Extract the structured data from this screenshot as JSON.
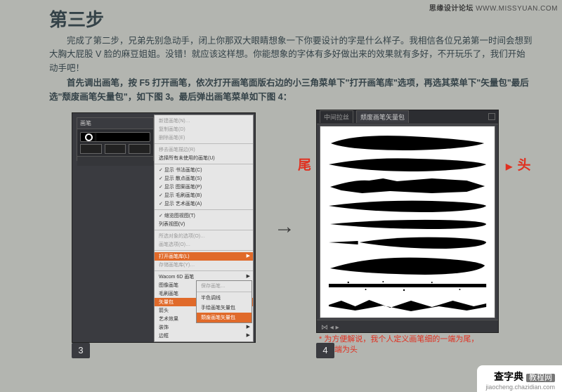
{
  "watermark_top": {
    "bold": "思缘设计论坛",
    "plain": "  WWW.MISSYUAN.COM"
  },
  "watermark_bottom": {
    "bold": "查字典",
    "sub": "教程网",
    "url": "jiaocheng.chazidian.com"
  },
  "heading": "第三步",
  "paragraph": "完成了第二步，兄弟先别急动手，闭上你那双大眼睛想象一下你要设计的字是什么样子。我相信各位兄弟第一时间会想到大胸大屁股 V 脸的麻豆姐姐。没错！就应该这样想。你能想象的字体有多好做出来的效果就有多好，不开玩乐了，我们开始动手吧！",
  "paragraph2": "首先调出画笔，按 F5 打开画笔，依次打开画笔面版右边的小三角菜单下\"打开画笔库\"选项，再选其菜单下\"矢量包\"最后选\"颓废画笔矢量包\"，如下图 3。最后弹出画笔菜单如下图 4：",
  "fig3": {
    "palette_tab": "画笔",
    "ctx_items_top": [
      "新建画笔(N)…",
      "复制画笔(D)",
      "删除画笔(E)"
    ],
    "ctx_items_mid1": [
      "移去画笔描边(R)",
      "选择所有未使用的画笔(U)"
    ],
    "ctx_items_mid2": [
      "显示 书法画笔(C)",
      "显示 散点画笔(S)",
      "显示 图案画笔(P)",
      "显示 毛刷画笔(B)",
      "显示 艺术画笔(A)"
    ],
    "ctx_items_mid3": [
      "缩览图视图(T)",
      "列表视图(V)"
    ],
    "ctx_items_mid4": [
      "所选对象的选项(O)…",
      "画笔选项(O)…"
    ],
    "ctx_open_lib": "打开画笔库(L)",
    "ctx_save_lib": "存储画笔库(Y)…",
    "ctx_vector": "矢量包",
    "flyout": [
      "保存画笔…",
      "半色调线",
      "手绘画笔矢量包",
      "颓废画笔矢量包"
    ]
  },
  "fig4": {
    "tabs": {
      "t1": "中间拉丝",
      "t2": "颓废画笔矢量包"
    }
  },
  "labels": {
    "left": "尾",
    "left_tri": "◀",
    "right": "头",
    "right_tri": "▶"
  },
  "footnote": {
    "l1": "* 为方便解说，我个人定义画笔细的一端为尾，",
    "l2": "另一端为头"
  },
  "badges": {
    "b3": "3",
    "b4": "4"
  }
}
